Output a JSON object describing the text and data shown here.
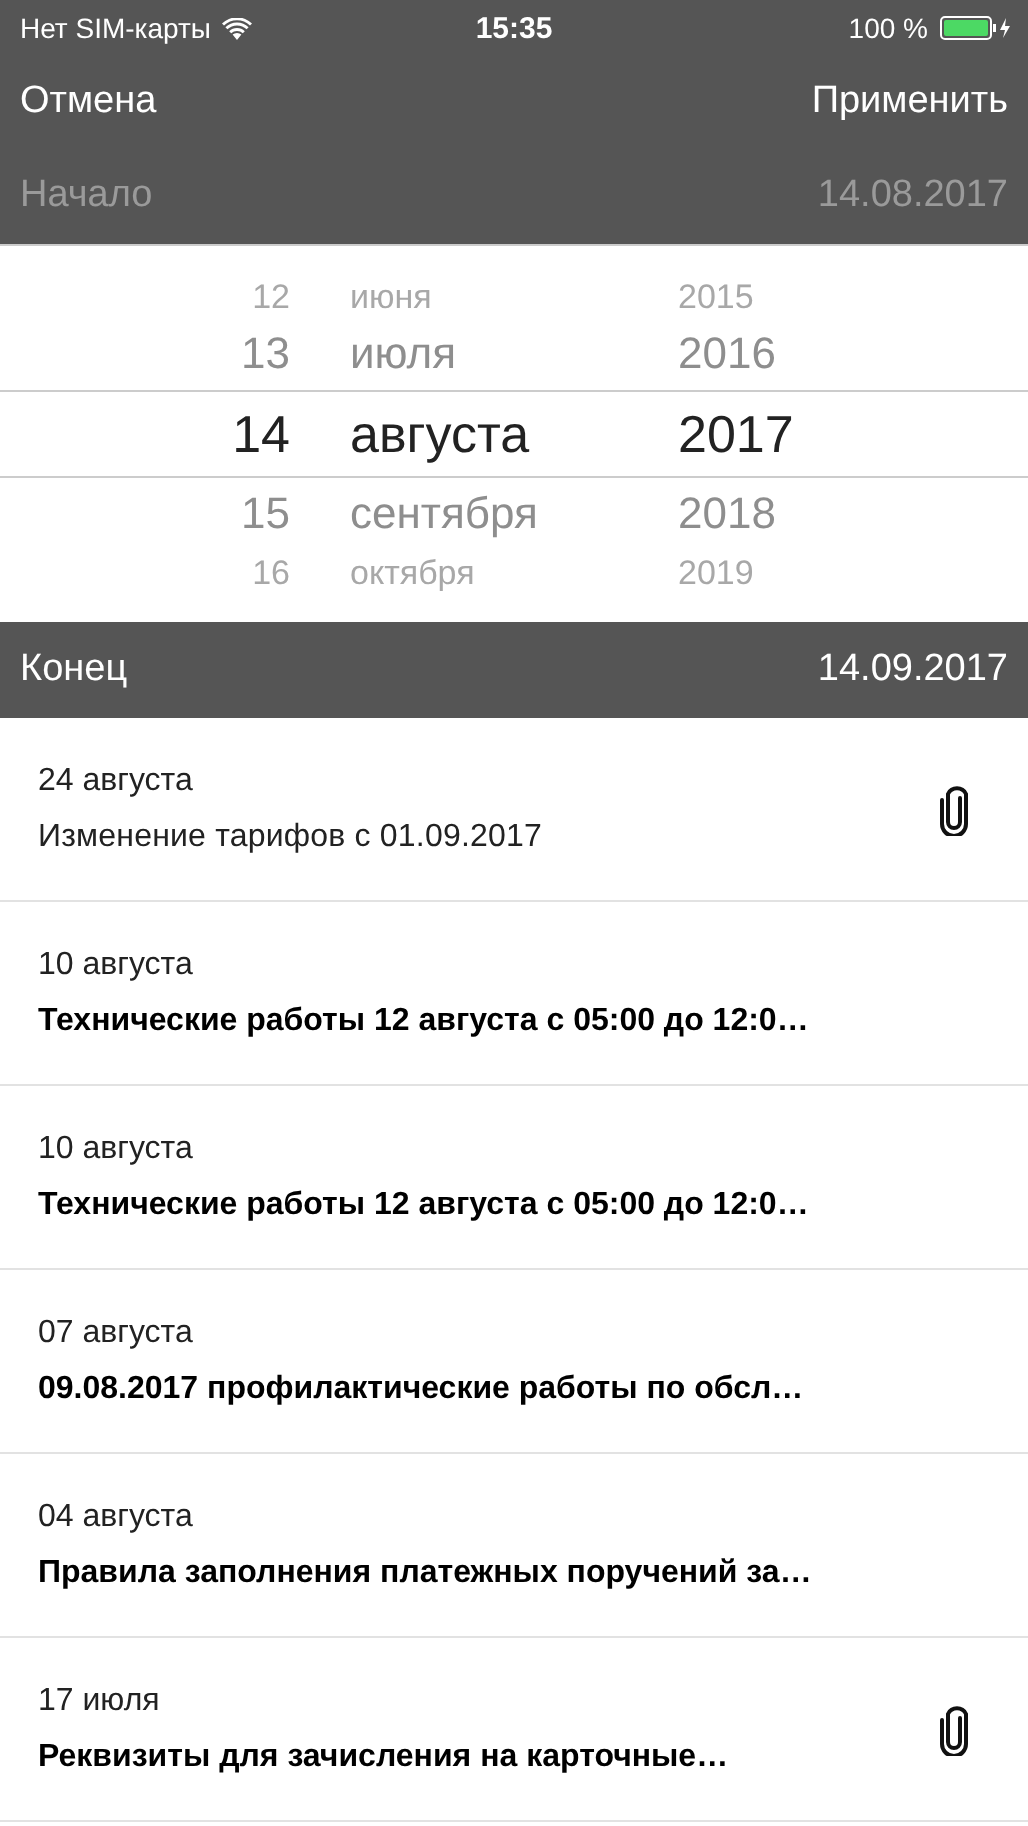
{
  "status_bar": {
    "carrier": "Нет SIM-карты",
    "time": "15:35",
    "battery": "100 %"
  },
  "nav": {
    "cancel": "Отмена",
    "apply": "Применить"
  },
  "start": {
    "label": "Начало",
    "value": "14.08.2017",
    "dimmed": true
  },
  "picker": {
    "columns": [
      {
        "kind": "day",
        "rows": [
          {
            "label": "12",
            "selected": false
          },
          {
            "label": "13",
            "selected": false
          },
          {
            "label": "14",
            "selected": true
          },
          {
            "label": "15",
            "selected": false
          },
          {
            "label": "16",
            "selected": false
          }
        ]
      },
      {
        "kind": "month",
        "rows": [
          {
            "label": "июня",
            "selected": false
          },
          {
            "label": "июля",
            "selected": false
          },
          {
            "label": "августа",
            "selected": true
          },
          {
            "label": "сентября",
            "selected": false
          },
          {
            "label": "октября",
            "selected": false
          }
        ]
      },
      {
        "kind": "year",
        "rows": [
          {
            "label": "2015",
            "selected": false
          },
          {
            "label": "2016",
            "selected": false
          },
          {
            "label": "2017",
            "selected": true
          },
          {
            "label": "2018",
            "selected": false
          },
          {
            "label": "2019",
            "selected": false
          }
        ]
      }
    ]
  },
  "end": {
    "label": "Конец",
    "value": "14.09.2017",
    "dimmed": false
  },
  "messages": [
    {
      "date": "24 августа",
      "title": "Изменение тарифов с 01.09.2017",
      "read": true,
      "attachment": true
    },
    {
      "date": "10 августа",
      "title": "Технические работы 12 августа с 05:00 до 12:0…",
      "read": false,
      "attachment": false
    },
    {
      "date": "10 августа",
      "title": "Технические работы 12 августа с 05:00 до 12:0…",
      "read": false,
      "attachment": false
    },
    {
      "date": "07 августа",
      "title": "09.08.2017 профилактические работы по обсл…",
      "read": false,
      "attachment": false
    },
    {
      "date": "04 августа",
      "title": "Правила заполнения платежных поручений за…",
      "read": false,
      "attachment": false
    },
    {
      "date": "17 июля",
      "title": "Реквизиты для зачисления на карточные…",
      "read": false,
      "attachment": true
    }
  ]
}
